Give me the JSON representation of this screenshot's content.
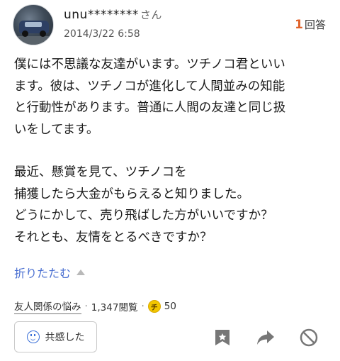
{
  "header": {
    "username": "unu********",
    "suffix": "さん",
    "date": "2014/3/22 6:58",
    "answer_count": "1",
    "answer_label": "回答"
  },
  "body": {
    "lines": [
      "僕には不思議な友達がいます。ツチノコ君といい",
      "ます。彼は、ツチノコが進化して人間並みの知能",
      "と行動性があります。普通に人間の友達と同じ扱",
      "いをしてます。",
      "",
      "最近、懸賞を見て、ツチノコを",
      "捕獲したら大金がもらえると知りました。",
      "どうにかして、売り飛ばした方がいいですか？",
      "それとも、友情をとるべきですか？"
    ]
  },
  "fold": {
    "label": "折りたたむ"
  },
  "meta": {
    "category": "友人関係の悩み",
    "views": "1,347閲覧",
    "coin_label": "チ",
    "coins": "50"
  },
  "actions": {
    "empathy_label": "共感した",
    "icons": [
      "bookmark-icon",
      "share-icon",
      "block-icon"
    ]
  },
  "colors": {
    "accent_orange": "#e0622a",
    "link_blue": "#4a6fd1",
    "icon_gray": "#777777"
  }
}
